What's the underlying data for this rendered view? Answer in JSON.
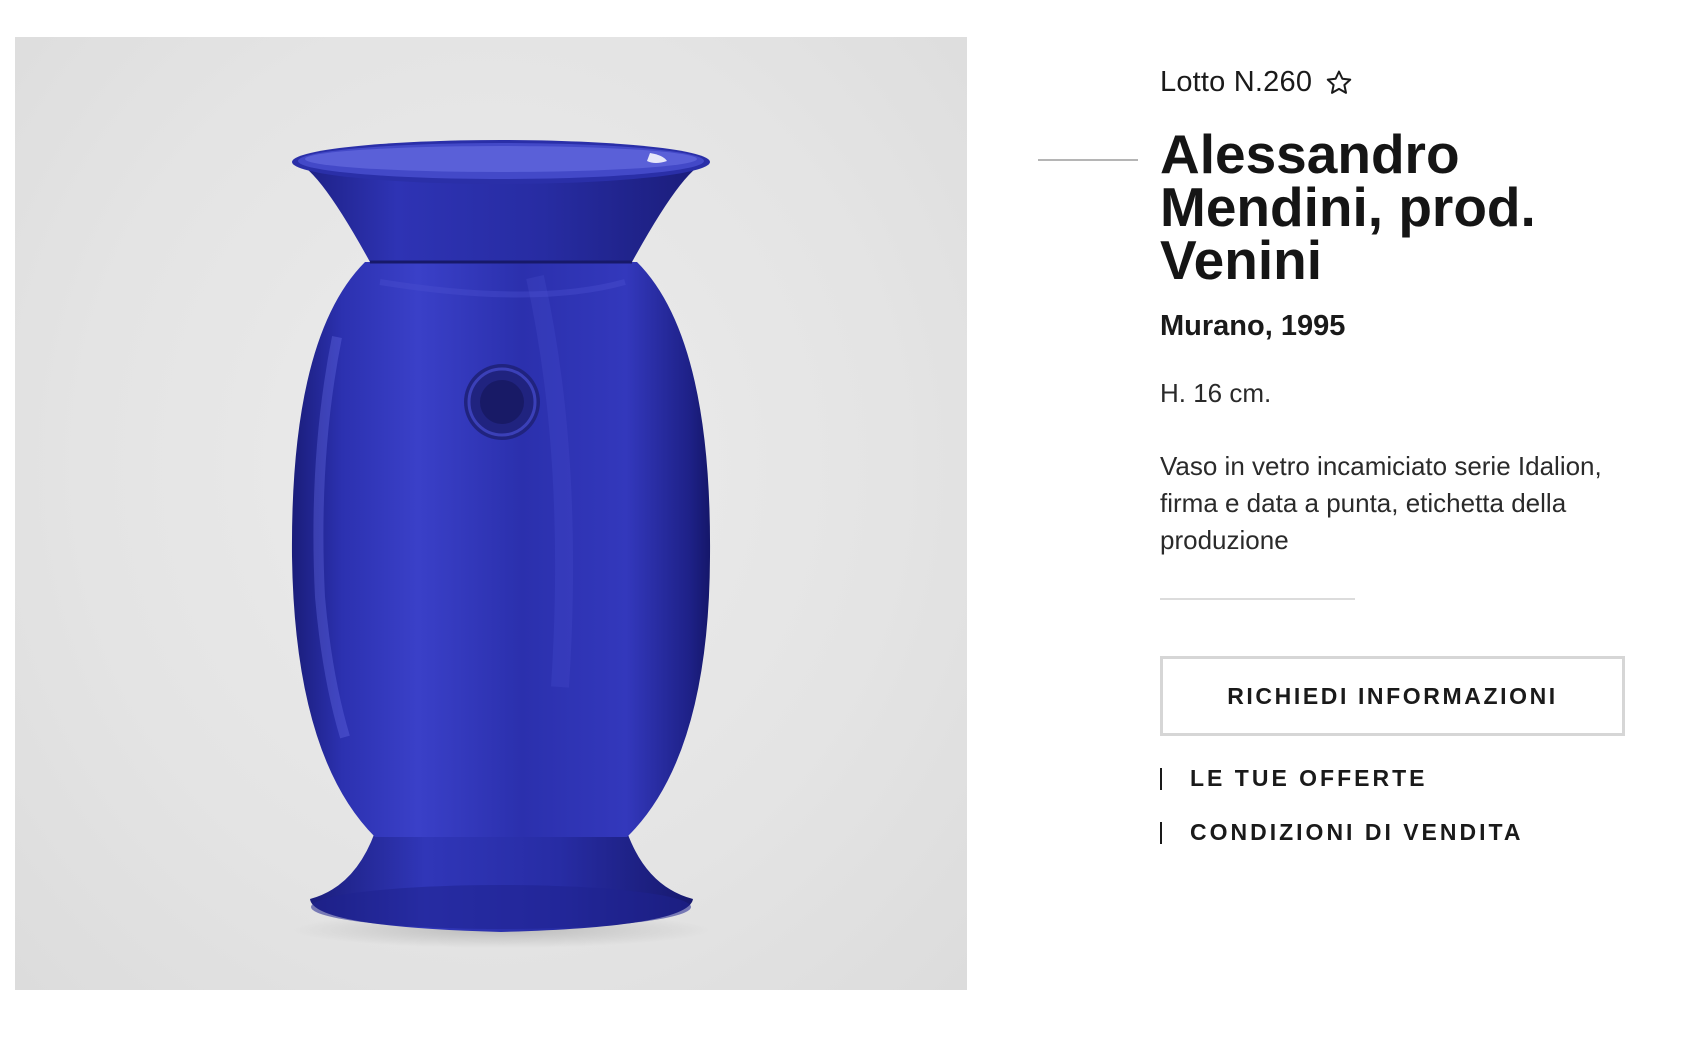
{
  "lot": {
    "number": "Lotto N.260",
    "favorite_icon": "star-outline-icon"
  },
  "artwork": {
    "title": "Alessandro Mendini, prod. Venini",
    "origin": "Murano, 1995",
    "dimensions": "H. 16 cm.",
    "description": "Vaso in vetro incamiciato serie Idalion, firma e data a punta, etichetta della produzione",
    "image_subject": "blue glass vase"
  },
  "actions": {
    "request_info_label": "RICHIEDI INFORMAZIONI",
    "offers_label": "LE TUE OFFERTE",
    "conditions_label": "CONDIZIONI DI VENDITA"
  },
  "colors": {
    "vase_blue": "#2a2fa8",
    "background_grey": "#e6e6e6",
    "text": "#1a1a1a",
    "button_border": "#d6d6d6"
  }
}
